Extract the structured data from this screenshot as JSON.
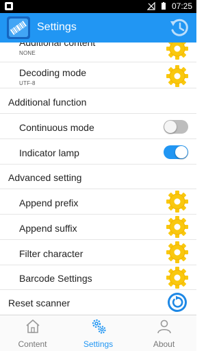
{
  "status_bar": {
    "time": "07:25"
  },
  "app_bar": {
    "title": "Settings"
  },
  "settings": {
    "additional_content": {
      "label": "Additional content",
      "value": "NONE"
    },
    "decoding_mode": {
      "label": "Decoding mode",
      "value": "UTF-8"
    },
    "additional_function": {
      "label": "Additional function"
    },
    "continuous_mode": {
      "label": "Continuous mode",
      "enabled": false
    },
    "indicator_lamp": {
      "label": "Indicator lamp",
      "enabled": true
    },
    "advanced_setting": {
      "label": "Advanced setting"
    },
    "append_prefix": {
      "label": "Append prefix"
    },
    "append_suffix": {
      "label": "Append suffix"
    },
    "filter_character": {
      "label": "Filter character"
    },
    "barcode_settings": {
      "label": "Barcode Settings"
    },
    "reset_scanner": {
      "label": "Reset scanner"
    }
  },
  "bottom_nav": {
    "items": [
      {
        "label": "Content",
        "icon": "home-icon",
        "active": false
      },
      {
        "label": "Settings",
        "icon": "gears-icon",
        "active": true
      },
      {
        "label": "About",
        "icon": "person-icon",
        "active": false
      }
    ]
  },
  "colors": {
    "primary": "#2196f3",
    "gear": "#fdd835",
    "gear_dark": "#f9a825"
  }
}
